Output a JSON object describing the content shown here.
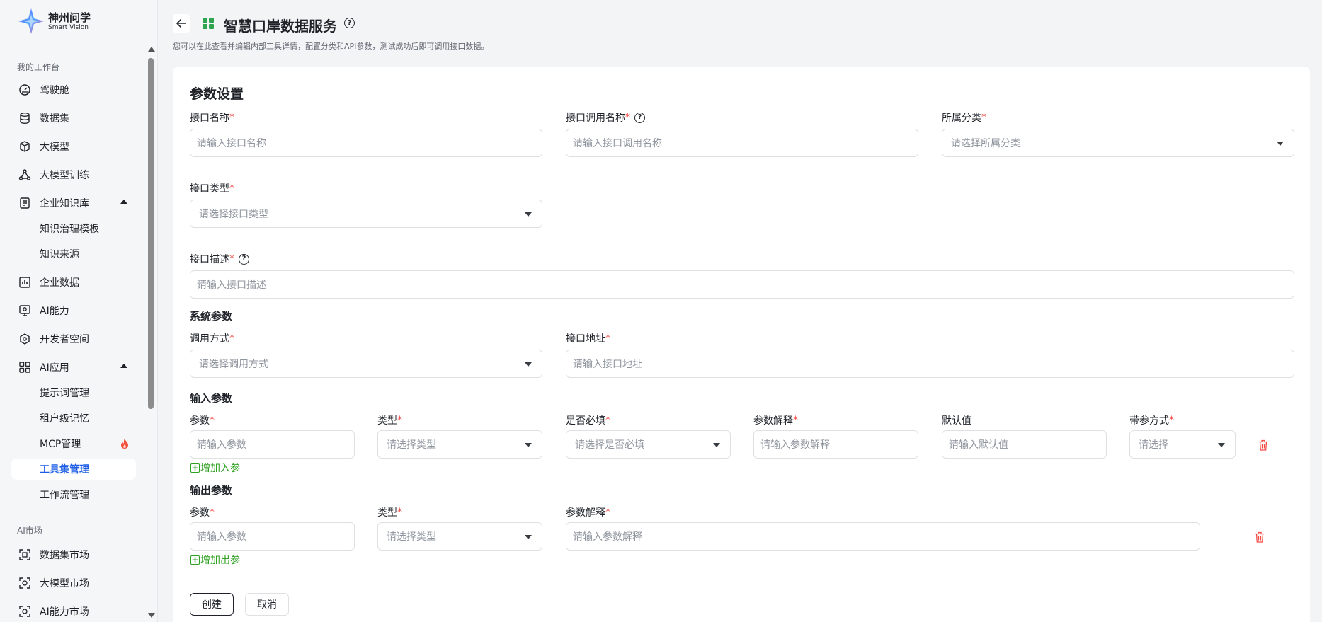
{
  "brand": {
    "name_cn": "神州问学",
    "name_en": "Smart Vision"
  },
  "sidebar": {
    "section_workspace": "我的工作台",
    "section_market": "AI市场",
    "items": [
      {
        "label": "驾驶舱",
        "icon": "dashboard-icon"
      },
      {
        "label": "数据集",
        "icon": "database-icon"
      },
      {
        "label": "大模型",
        "icon": "cube-icon"
      },
      {
        "label": "大模型训练",
        "icon": "training-icon"
      },
      {
        "label": "企业知识库",
        "icon": "knowledge-icon",
        "expanded": true
      },
      {
        "label": "知识治理模板"
      },
      {
        "label": "知识来源"
      },
      {
        "label": "企业数据",
        "icon": "chart-icon"
      },
      {
        "label": "AI能力",
        "icon": "ai-ability-icon"
      },
      {
        "label": "开发者空间",
        "icon": "developer-icon"
      },
      {
        "label": "AI应用",
        "icon": "grid-icon",
        "expanded": true
      },
      {
        "label": "提示词管理"
      },
      {
        "label": "租户级记忆"
      },
      {
        "label": "MCP管理",
        "badge": "fire-icon"
      },
      {
        "label": "工具集管理",
        "active": true
      },
      {
        "label": "工作流管理"
      },
      {
        "label": "数据集市场",
        "icon": "scan-icon"
      },
      {
        "label": "大模型市场",
        "icon": "scan-icon"
      },
      {
        "label": "AI能力市场",
        "icon": "scan-icon"
      }
    ]
  },
  "header": {
    "title": "智慧口岸数据服务",
    "description": "您可以在此查看并编辑内部工具详情，配置分类和API参数，测试成功后即可调用接口数据。"
  },
  "form": {
    "section_title": "参数设置",
    "api_name": {
      "label": "接口名称",
      "placeholder": "请输入接口名称"
    },
    "api_call_name": {
      "label": "接口调用名称",
      "placeholder": "请输入接口调用名称"
    },
    "category": {
      "label": "所属分类",
      "placeholder": "请选择所属分类"
    },
    "api_type": {
      "label": "接口类型",
      "placeholder": "请选择接口类型"
    },
    "api_desc": {
      "label": "接口描述",
      "placeholder": "请输入接口描述"
    },
    "system_params": {
      "title": "系统参数",
      "call_method": {
        "label": "调用方式",
        "placeholder": "请选择调用方式"
      },
      "api_address": {
        "label": "接口地址",
        "placeholder": "请输入接口地址"
      }
    },
    "input_params": {
      "title": "输入参数",
      "columns": {
        "param": "参数",
        "type": "类型",
        "required": "是否必填",
        "explain": "参数解释",
        "default": "默认值",
        "method": "带参方式"
      },
      "row": {
        "param": "请输入参数",
        "type": "请选择类型",
        "required": "请选择是否必填",
        "explain": "请输入参数解释",
        "default": "请输入默认值",
        "method": "请选择"
      },
      "add_label": "增加入参"
    },
    "output_params": {
      "title": "输出参数",
      "columns": {
        "param": "参数",
        "type": "类型",
        "explain": "参数解释"
      },
      "row": {
        "param": "请输入参数",
        "type": "请选择类型",
        "explain": "请输入参数解释"
      },
      "add_label": "增加出参"
    },
    "create_label": "创建",
    "cancel_label": "取消"
  },
  "colors": {
    "accent": "#1e5ee6",
    "required": "#f54a45",
    "add_link": "#2ea121",
    "danger": "#f54a45"
  }
}
